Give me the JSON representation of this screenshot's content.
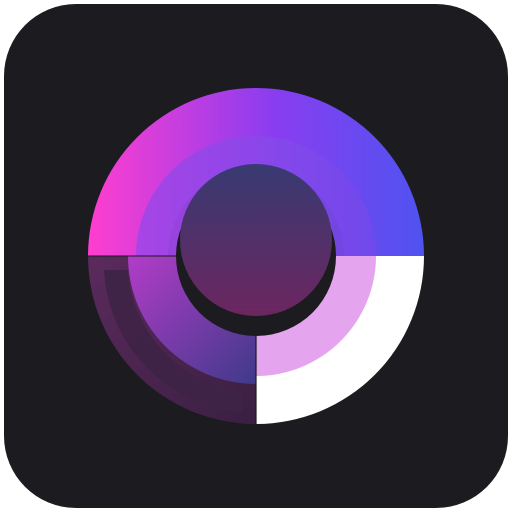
{
  "icon": {
    "background_color": "#1c1b1f",
    "colors": {
      "magenta": "#ff3ecf",
      "violet": "#8a3df0",
      "blue": "#4f53f0",
      "light_purple": "#e4a4ee",
      "white": "#ffffff",
      "dark_plum": "#5b2a5d",
      "center_top": "#383a72",
      "center_bottom": "#6c2660"
    }
  }
}
